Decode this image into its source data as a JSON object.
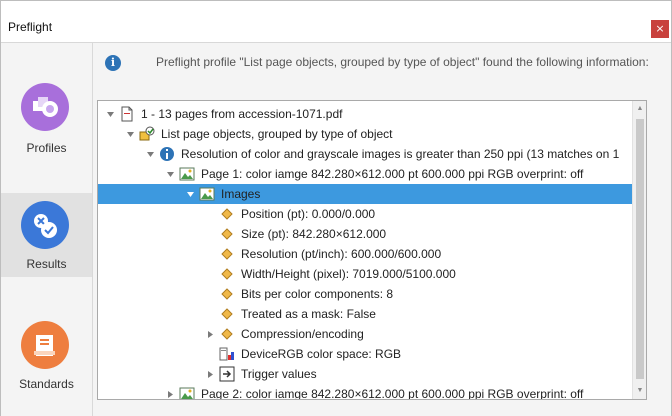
{
  "window": {
    "title": "Preflight",
    "close_label": "×"
  },
  "sidebar": {
    "items": [
      {
        "label": "Profiles",
        "color": "#a86fdb"
      },
      {
        "label": "Results",
        "color": "#3b78d8"
      },
      {
        "label": "Standards",
        "color": "#ee7e3f"
      }
    ]
  },
  "main": {
    "info_icon": "i",
    "message": "Preflight profile \"List page objects, grouped by type of object\" found the following information:"
  },
  "tree": {
    "rows": [
      {
        "label": "1 - 13 pages from accession-1071.pdf",
        "icon": "page-icon",
        "twisty": "expanded"
      },
      {
        "label": "List page objects, grouped by type of object",
        "icon": "profile-icon",
        "twisty": "expanded"
      },
      {
        "label": "Resolution of color and grayscale images is greater than 250 ppi (13 matches on 1",
        "icon": "info-icon",
        "twisty": "expanded"
      },
      {
        "label": "Page 1:  color iamge 842.280×612.000 pt 600.000 ppi RGB overprint: off",
        "icon": "image-icon",
        "twisty": "expanded"
      },
      {
        "label": "Images",
        "icon": "image-icon",
        "twisty": "expanded",
        "selected": true
      },
      {
        "label": "Position (pt): 0.000/0.000",
        "icon": "diamond-icon",
        "twisty": ""
      },
      {
        "label": "Size (pt): 842.280×612.000",
        "icon": "diamond-icon",
        "twisty": ""
      },
      {
        "label": "Resolution (pt/inch): 600.000/600.000",
        "icon": "diamond-icon",
        "twisty": ""
      },
      {
        "label": "Width/Height (pixel): 7019.000/5100.000",
        "icon": "diamond-icon",
        "twisty": ""
      },
      {
        "label": "Bits per color components: 8",
        "icon": "diamond-icon",
        "twisty": ""
      },
      {
        "label": "Treated as a mask: False",
        "icon": "diamond-icon",
        "twisty": ""
      },
      {
        "label": "Compression/encoding",
        "icon": "diamond-icon",
        "twisty": "collapsed"
      },
      {
        "label": "DeviceRGB color space: RGB",
        "icon": "colorspace-icon",
        "twisty": ""
      },
      {
        "label": "Trigger values",
        "icon": "trigger-icon",
        "twisty": "collapsed"
      },
      {
        "label": "Page 2:  color iamge 842.280×612.000 pt 600.000 ppi RGB overprint: off",
        "icon": "image-icon",
        "twisty": "collapsed"
      }
    ]
  }
}
